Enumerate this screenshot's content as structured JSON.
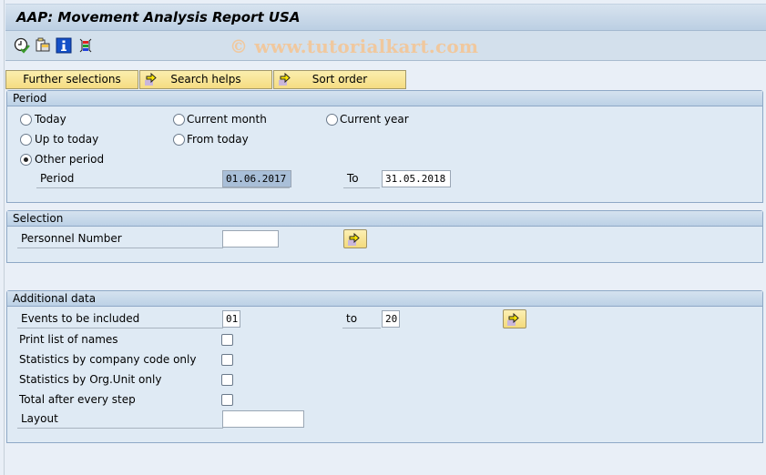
{
  "window": {
    "title": "AAP: Movement Analysis Report USA",
    "watermark": "© www.tutorialkart.com"
  },
  "toolbar": {
    "icons": [
      "execute-clock-icon",
      "copy-variant-icon",
      "info-icon",
      "layout-columns-icon"
    ]
  },
  "buttons": {
    "further_selections": "Further selections",
    "search_helps": "Search helps",
    "sort_order": "Sort order"
  },
  "period": {
    "header": "Period",
    "options": [
      {
        "label": "Today",
        "selected": false
      },
      {
        "label": "Current month",
        "selected": false
      },
      {
        "label": "Current year",
        "selected": false
      },
      {
        "label": "Up to today",
        "selected": false
      },
      {
        "label": "From today",
        "selected": false
      },
      {
        "label": "Other period",
        "selected": true
      }
    ],
    "period_label": "Period",
    "from_value": "01.06.2017",
    "to_label": "To",
    "to_value": "31.05.2018"
  },
  "selection": {
    "header": "Selection",
    "personnel_number_label": "Personnel Number",
    "personnel_number_value": ""
  },
  "additional": {
    "header": "Additional data",
    "events_label": "Events to be included",
    "events_from": "01",
    "events_to_label": "to",
    "events_to": "20",
    "print_list_label": "Print list of names",
    "print_list_checked": false,
    "stats_company_label": "Statistics by company code only",
    "stats_company_checked": false,
    "stats_orgunit_label": "Statistics by Org.Unit only",
    "stats_orgunit_checked": false,
    "total_step_label": "Total after every step",
    "total_step_checked": false,
    "layout_label": "Layout",
    "layout_value": ""
  }
}
